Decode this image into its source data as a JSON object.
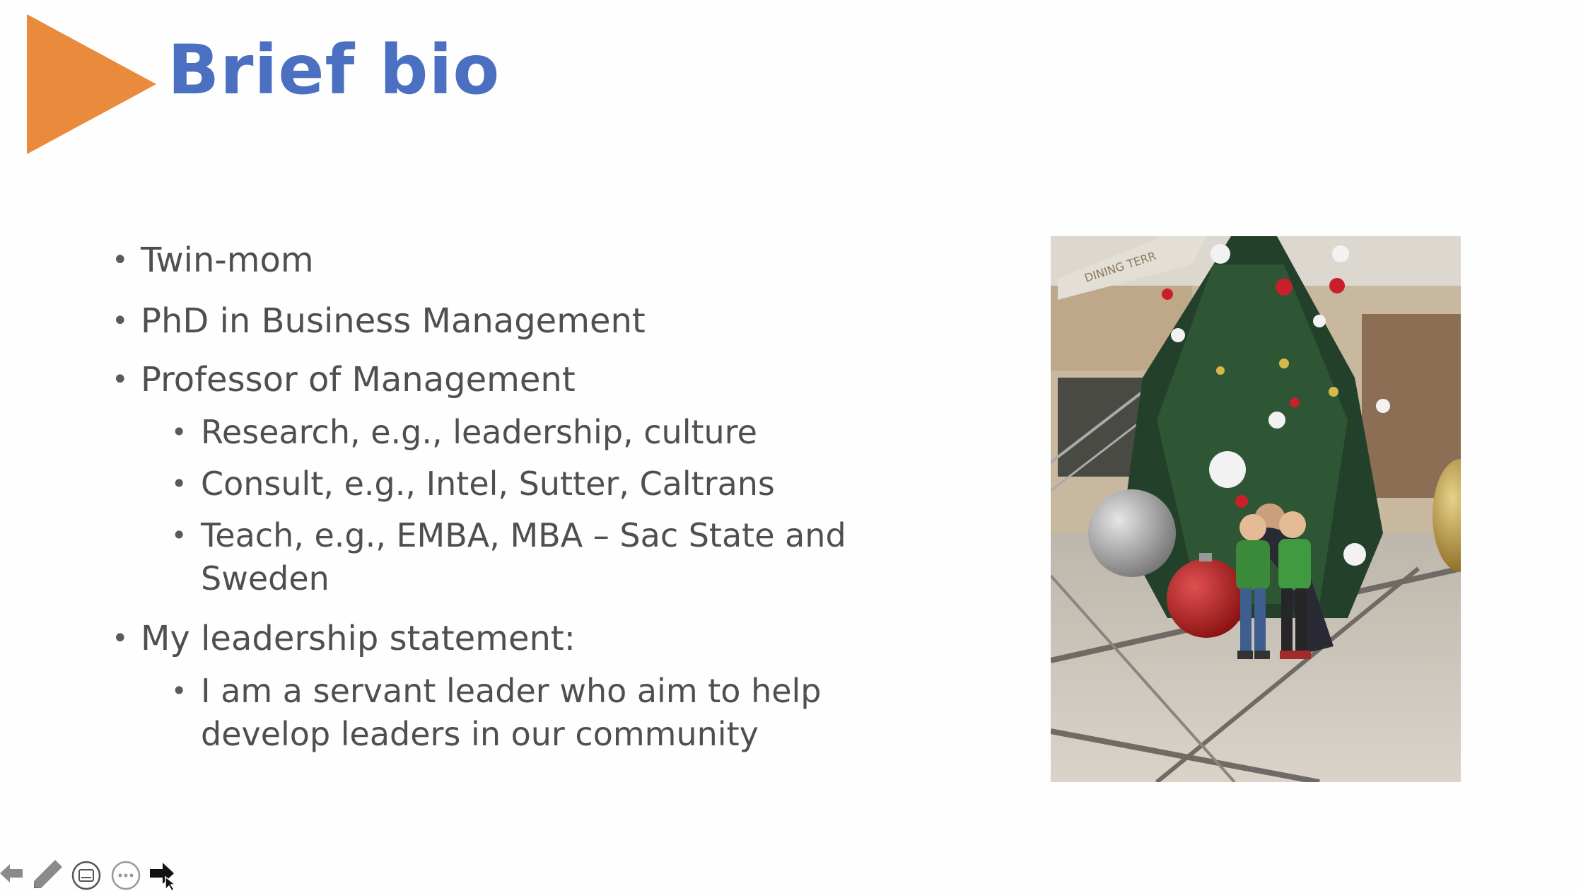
{
  "slide": {
    "title": "Brief bio",
    "bullets": [
      {
        "text": "Twin-mom"
      },
      {
        "text": "PhD in Business Management"
      },
      {
        "text": "Professor of Management",
        "sub": [
          "Research, e.g., leadership, culture",
          "Consult, e.g., Intel, Sutter, Caltrans",
          "Teach, e.g., EMBA, MBA – Sac State and",
          "Sweden"
        ]
      },
      {
        "text": "My leadership statement:",
        "sub": [
          "I am a servant leader who aim to help",
          "develop leaders in our community"
        ]
      }
    ],
    "bullet_glyph": "•",
    "photo": "family-christmas-photo",
    "photo_sign_text": "DINING TERR"
  },
  "colors": {
    "title": "#4b6fc1",
    "arrow": "#ea8a3d",
    "body_text": "#4f4f4f"
  },
  "toolbar": {
    "icons": [
      "previous-arrow-icon",
      "pen-icon",
      "subtitles-icon",
      "more-options-icon",
      "next-arrow-icon"
    ]
  }
}
